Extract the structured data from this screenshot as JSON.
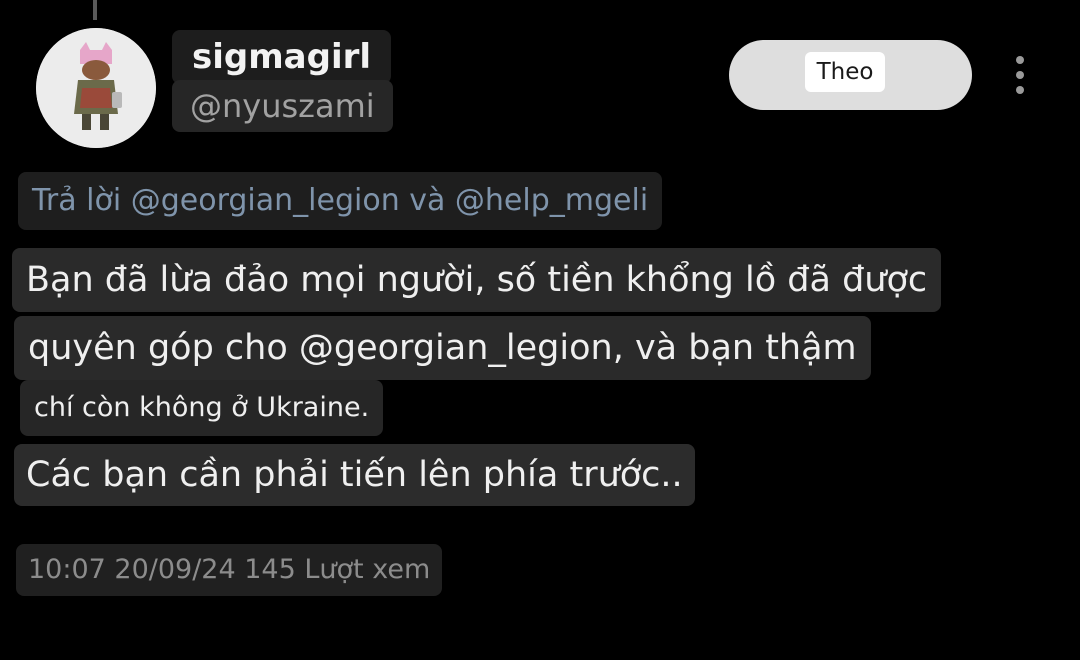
{
  "user": {
    "display_name": "sigmagirl",
    "handle": "@nyuszami",
    "avatar_icon": "profile-avatar"
  },
  "actions": {
    "follow_label": "Theo",
    "more_icon": "more-vertical-icon"
  },
  "post": {
    "reply_to": "Trả lời @georgian_legion và @help_mgeli",
    "lines": [
      "Bạn đã lừa đảo mọi người, số tiền khổng lồ đã được",
      "quyên góp cho @georgian_legion, và bạn thậm",
      "chí còn không ở Ukraine.",
      "Các bạn cần phải tiến lên phía trước.."
    ],
    "meta": "10:07 20/09/24 145 Lượt xem"
  },
  "colors": {
    "background": "#000000",
    "reply_link": "#7f94ab",
    "follow_button": "#dedede"
  }
}
